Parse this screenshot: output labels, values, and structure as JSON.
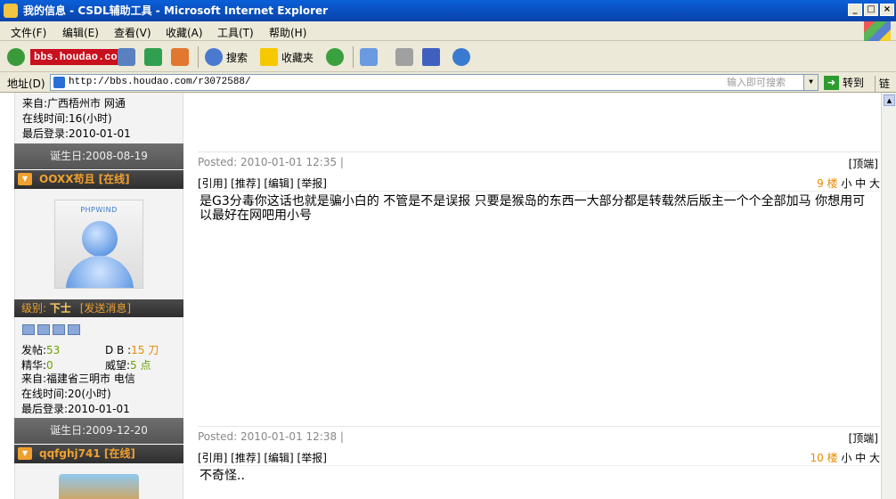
{
  "window": {
    "title": "我的信息 - CSDL辅助工具 - Microsoft Internet Explorer"
  },
  "menu": [
    "文件(F)",
    "编辑(E)",
    "查看(V)",
    "收藏(A)",
    "工具(T)",
    "帮助(H)"
  ],
  "toolbar": {
    "watermark": "bbs.houdao.com",
    "search_label": "搜索",
    "favorites_label": "收藏夹"
  },
  "address": {
    "label": "地址(D)",
    "url": "http://bbs.houdao.com/r3072588/",
    "search_hint": "输入即可搜索",
    "go_label": "转到",
    "links_label": "链接"
  },
  "posts": [
    {
      "user_info": {
        "from": "来自:广西梧州市 网通",
        "online": "在线时间:16(小时)",
        "last_login": "最后登录:2010-01-01"
      },
      "birthday": "诞生日:2008-08-19",
      "posted": "Posted: 2010-01-01 12:35 |",
      "top_link": "[顶端]"
    },
    {
      "username": "OOXX苟且 [在线]",
      "avatar_brand": "PHPWIND",
      "rank_label": "级别:",
      "rank": "下士",
      "send_msg": "[发送消息]",
      "stats": {
        "posts_label": "发帖:",
        "posts": "53",
        "db_label": "D B :",
        "db": "15 刀",
        "elite_label": "精华:",
        "elite": "0",
        "prestige_label": "威望:",
        "prestige": "5 点"
      },
      "user_info": {
        "from": "来自:福建省三明市 电信",
        "online": "在线时间:20(小时)",
        "last_login": "最后登录:2010-01-01"
      },
      "birthday": "诞生日:2009-12-20",
      "actions": "[引用] [推荐] [编辑] [举报]",
      "floor_num": "9 楼",
      "font_sizes": "小 中 大",
      "body": "是G3分毒你这话也就是骗小白的 不管是不是误报 只要是猴岛的东西一大部分都是转载然后版主一个个全部加马 你想用可以最好在网吧用小号",
      "posted": "Posted: 2010-01-01 12:38 |",
      "top_link": "[顶端]"
    },
    {
      "username": "qqfghj741 [在线]",
      "actions": "[引用] [推荐] [编辑] [举报]",
      "floor_num": "10 楼",
      "font_sizes": "小 中 大",
      "body": "不奇怪.."
    }
  ]
}
